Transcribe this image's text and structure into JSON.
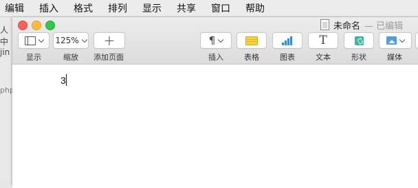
{
  "menubar": {
    "items": [
      "编辑",
      "插入",
      "格式",
      "排列",
      "显示",
      "共享",
      "窗口",
      "帮助"
    ]
  },
  "background_window": {
    "fragments": [
      "人中",
      "jin",
      "php"
    ]
  },
  "window": {
    "document_name": "未命名",
    "document_status": "— 已编辑",
    "toolbar": {
      "view": {
        "label": "显示",
        "icon": "view-icon"
      },
      "zoom": {
        "label": "缩放",
        "value": "125%"
      },
      "add_page": {
        "label": "添加页面",
        "icon": "plus-icon"
      },
      "insert": {
        "label": "插入",
        "icon": "pilcrow-icon"
      },
      "table": {
        "label": "表格",
        "icon": "table-icon"
      },
      "chart": {
        "label": "图表",
        "icon": "chart-icon"
      },
      "text": {
        "label": "文本",
        "icon": "text-icon"
      },
      "shape": {
        "label": "形状",
        "icon": "shape-icon"
      },
      "media": {
        "label": "媒体",
        "icon": "media-icon"
      }
    }
  },
  "document": {
    "body_text": "3"
  },
  "colors": {
    "close": "#fc605c",
    "minimize": "#fdbc40",
    "zoom": "#34c84a",
    "table_accent": "#f5d33e",
    "chart_accent": "#2d8de8",
    "shape_accent": "#3ab89d",
    "media_accent": "#4f9fe0"
  }
}
